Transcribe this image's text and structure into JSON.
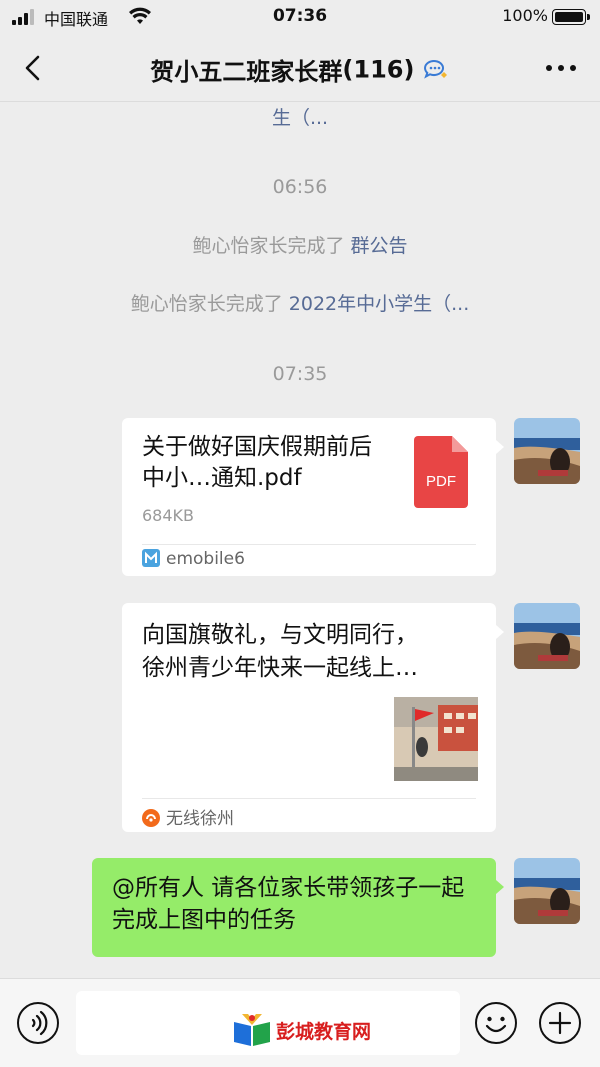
{
  "status_bar": {
    "carrier": "中国联通",
    "time": "07:36",
    "battery": "100%"
  },
  "nav": {
    "title": "贺小五二班家长群",
    "member_count": "(116)"
  },
  "messages": {
    "system_top_partial": "生（...",
    "timestamp_1": "06:56",
    "system_1_text": "鲍心怡家长完成了 ",
    "system_1_link": "群公告",
    "system_2_text": "鲍心怡家长完成了 ",
    "system_2_link": "2022年中小学生（...",
    "timestamp_2": "07:35",
    "file_card": {
      "title": "关于做好国庆假期前后中小…通知.pdf",
      "file_type": "PDF",
      "size": "684KB",
      "source": "emobile6"
    },
    "link_card": {
      "title_line1": "向国旗敬礼，与文明同行，",
      "title_line2": "徐州青少年快来一起线上…",
      "source": "无线徐州"
    },
    "text_bubble": "@所有人 请各位家长带领孩子一起完成上图中的任务"
  },
  "watermark": {
    "text": "彭城教育网"
  },
  "colors": {
    "background": "#ededed",
    "bubble_green": "#95ec69",
    "link_blue": "#576b95",
    "pdf_red": "#e84545",
    "watermark_red": "#d81e1e"
  },
  "icons": {
    "back": "chevron-left-icon",
    "group_chat": "group-chat-icon",
    "more": "more-dots-icon",
    "voice": "voice-icon",
    "emoji": "emoji-icon",
    "plus": "plus-icon"
  }
}
